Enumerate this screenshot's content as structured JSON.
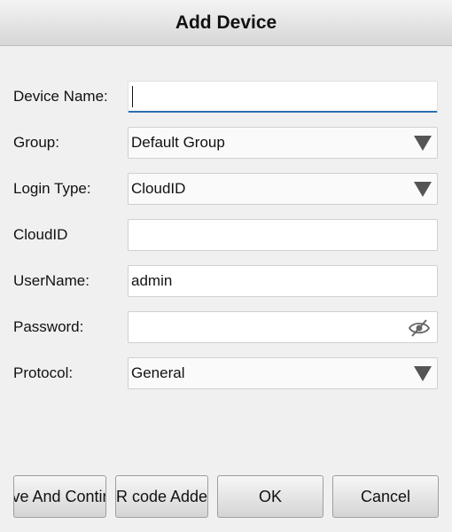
{
  "dialog": {
    "title": "Add Device"
  },
  "form": {
    "device_name": {
      "label": "Device Name:",
      "value": ""
    },
    "group": {
      "label": "Group:",
      "value": "Default Group"
    },
    "login_type": {
      "label": "Login Type:",
      "value": "CloudID"
    },
    "cloud_id": {
      "label": "CloudID",
      "value": ""
    },
    "username": {
      "label": "UserName:",
      "value": "admin"
    },
    "password": {
      "label": "Password:",
      "value": ""
    },
    "protocol": {
      "label": "Protocol:",
      "value": "General"
    }
  },
  "buttons": {
    "save_continue": "ve And Contir",
    "qr_add": "R code Adde",
    "ok": "OK",
    "cancel": "Cancel"
  },
  "icons": {
    "password_toggle": "eye-slash-icon",
    "dropdown": "triangle-down-icon"
  }
}
